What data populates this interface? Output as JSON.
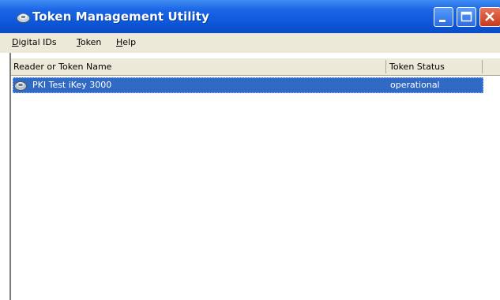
{
  "window": {
    "title": "Token Management Utility"
  },
  "menu": {
    "items": [
      "Digital IDs",
      "Token",
      "Help"
    ]
  },
  "table": {
    "columns": [
      "Reader or Token Name",
      "Token Status"
    ],
    "rows": [
      {
        "name": "PKI Test iKey 3000",
        "status": "operational",
        "selected": true
      }
    ]
  },
  "icons": {
    "app": "token-icon",
    "row": "key-token-icon",
    "minimize": "minimize-icon",
    "maximize": "maximize-icon",
    "close": "close-icon"
  },
  "colors": {
    "title_bar": "#0d56d8",
    "selection": "#316ac5",
    "menu_bg": "#ece9d8",
    "close_button": "#c8391a"
  }
}
